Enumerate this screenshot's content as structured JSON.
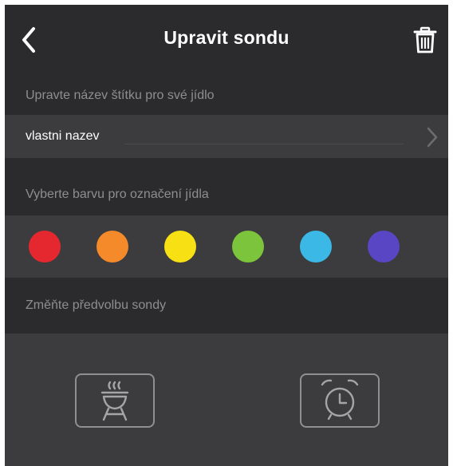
{
  "header": {
    "title": "Upravit sondu",
    "back_icon": "chevron-left-icon",
    "delete_icon": "trash-icon"
  },
  "label_section": {
    "heading": "Upravte název štítku pro své jídlo",
    "current_name": "vlastni nazev",
    "chevron_icon": "chevron-right-icon"
  },
  "color_section": {
    "heading": "Vyberte barvu pro označení jídla",
    "colors": [
      "#e5282f",
      "#f58a2b",
      "#f7e115",
      "#7cc43b",
      "#3bb8e6",
      "#5946c4"
    ]
  },
  "preset_section": {
    "heading": "Změňte předvolbu sondy",
    "presets": [
      {
        "icon": "grill-icon"
      },
      {
        "icon": "alarm-clock-icon"
      }
    ]
  }
}
